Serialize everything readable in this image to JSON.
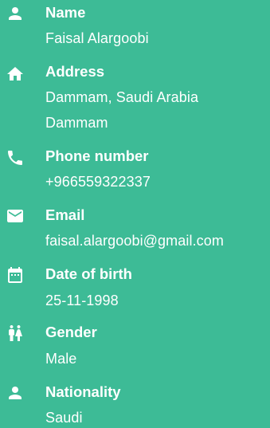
{
  "colors": {
    "background": "#3dbb96",
    "text": "#ffffff"
  },
  "fields": [
    {
      "icon": "person-icon",
      "label": "Name",
      "lines": [
        "Faisal Alargoobi"
      ]
    },
    {
      "icon": "home-icon",
      "label": "Address",
      "lines": [
        "Dammam, Saudi Arabia",
        "Dammam"
      ]
    },
    {
      "icon": "phone-icon",
      "label": "Phone number",
      "lines": [
        "+966559322337"
      ]
    },
    {
      "icon": "envelope-icon",
      "label": "Email",
      "lines": [
        "faisal.alargoobi@gmail.com"
      ]
    },
    {
      "icon": "calendar-icon",
      "label": "Date of birth",
      "lines": [
        "25-11-1998"
      ]
    },
    {
      "icon": "gender-icon",
      "label": "Gender",
      "lines": [
        "Male"
      ]
    },
    {
      "icon": "person-icon",
      "label": "Nationality",
      "lines": [
        "Saudi"
      ]
    }
  ]
}
